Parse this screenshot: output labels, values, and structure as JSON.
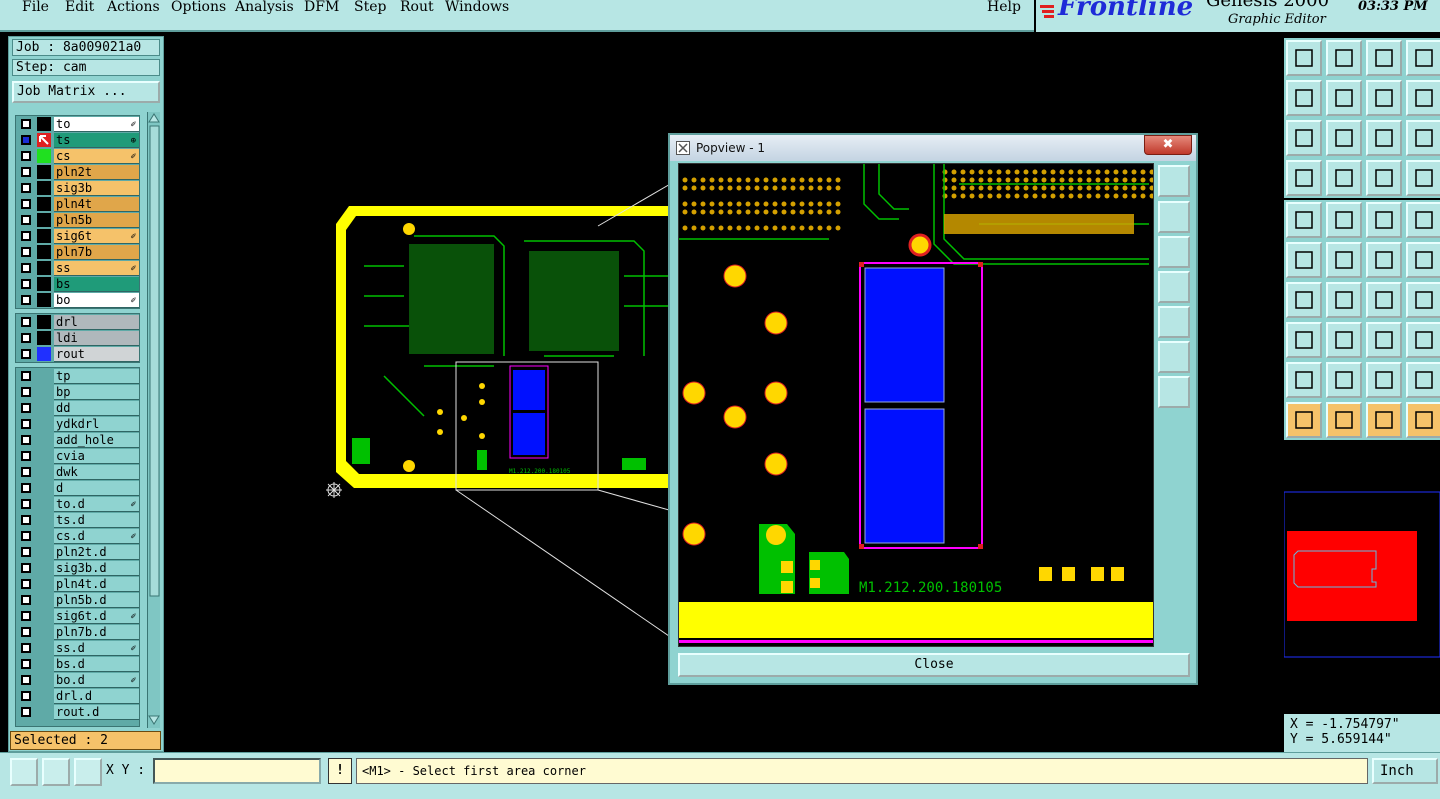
{
  "menu": {
    "items": [
      "File",
      "Edit",
      "Actions",
      "Options",
      "Analysis",
      "DFM",
      "Step",
      "Rout",
      "Windows"
    ],
    "help": "Help"
  },
  "brand": {
    "logo": "Frontline",
    "title": "Genesis 2000",
    "subtitle": "Graphic Editor",
    "clock": "03:33 PM"
  },
  "job": {
    "job_label": "Job : 8a009021a0",
    "step_label": "Step: cam",
    "matrix_button": "Job Matrix ..."
  },
  "layers": {
    "board": [
      {
        "name": "to",
        "color": "#ffffff",
        "swatch": "#000000",
        "tag": "✐"
      },
      {
        "name": "ts",
        "color": "#1f9b79",
        "swatch": "#e0e0e0",
        "tag": "⊕",
        "icon": "cursor"
      },
      {
        "name": "cs",
        "color": "#f5c26a",
        "swatch": "#20e020",
        "tag": "✐"
      },
      {
        "name": "pln2t",
        "color": "#e0a64a",
        "swatch": "#000000",
        "tag": ""
      },
      {
        "name": "sig3b",
        "color": "#f5c26a",
        "swatch": "#000000",
        "tag": ""
      },
      {
        "name": "pln4t",
        "color": "#e0a64a",
        "swatch": "#000000",
        "tag": ""
      },
      {
        "name": "pln5b",
        "color": "#e0a64a",
        "swatch": "#000000",
        "tag": ""
      },
      {
        "name": "sig6t",
        "color": "#f5c26a",
        "swatch": "#000000",
        "tag": "✐"
      },
      {
        "name": "pln7b",
        "color": "#e0a64a",
        "swatch": "#000000",
        "tag": ""
      },
      {
        "name": "ss",
        "color": "#f5c26a",
        "swatch": "#000000",
        "tag": "✐"
      },
      {
        "name": "bs",
        "color": "#1f9b79",
        "swatch": "#000000",
        "tag": ""
      },
      {
        "name": "bo",
        "color": "#ffffff",
        "swatch": "#000000",
        "tag": "✐"
      }
    ],
    "drill": [
      {
        "name": "drl",
        "color": "#b0b8bc",
        "swatch": "#000000",
        "tag": ""
      },
      {
        "name": "ldi",
        "color": "#b0b8bc",
        "swatch": "#000000",
        "tag": ""
      },
      {
        "name": "rout",
        "color": "#d0d4d6",
        "swatch": "#2030ff",
        "tag": ""
      }
    ],
    "misc": [
      {
        "name": "tp",
        "tag": ""
      },
      {
        "name": "bp",
        "tag": ""
      },
      {
        "name": "dd",
        "tag": ""
      },
      {
        "name": "ydkdrl",
        "tag": ""
      },
      {
        "name": "add_hole",
        "tag": ""
      },
      {
        "name": "cvia",
        "tag": ""
      },
      {
        "name": "dwk",
        "tag": ""
      },
      {
        "name": "d",
        "tag": ""
      },
      {
        "name": "to.d",
        "tag": "✐"
      },
      {
        "name": "ts.d",
        "tag": ""
      },
      {
        "name": "cs.d",
        "tag": "✐"
      },
      {
        "name": "pln2t.d",
        "tag": ""
      },
      {
        "name": "sig3b.d",
        "tag": ""
      },
      {
        "name": "pln4t.d",
        "tag": ""
      },
      {
        "name": "pln5b.d",
        "tag": ""
      },
      {
        "name": "sig6t.d",
        "tag": "✐"
      },
      {
        "name": "pln7b.d",
        "tag": ""
      },
      {
        "name": "ss.d",
        "tag": "✐"
      },
      {
        "name": "bs.d",
        "tag": ""
      },
      {
        "name": "bo.d",
        "tag": "✐"
      },
      {
        "name": "drl.d",
        "tag": ""
      },
      {
        "name": "rout.d",
        "tag": ""
      }
    ]
  },
  "status": {
    "selected": "Selected : 2",
    "xy_label": "X Y :",
    "xy_value": "",
    "prompt": "<M1> - Select first area corner",
    "unit": "Inch",
    "alert": "!"
  },
  "coords": {
    "x": "X = -1.754797\"",
    "y": "Y = 5.659144\""
  },
  "popview": {
    "title": "Popview - 1",
    "close_x": "✖",
    "close_button": "Close",
    "silk_text": "M1.212.200.180105"
  },
  "board_silk_text": "M1.212.200.180105",
  "colors": {
    "panel": "#8fd3d0",
    "yellow": "#ffff00",
    "trace": "#00c000",
    "pad": "#ffd700",
    "blue": "#0010ff",
    "magenta": "#ff00ff"
  }
}
